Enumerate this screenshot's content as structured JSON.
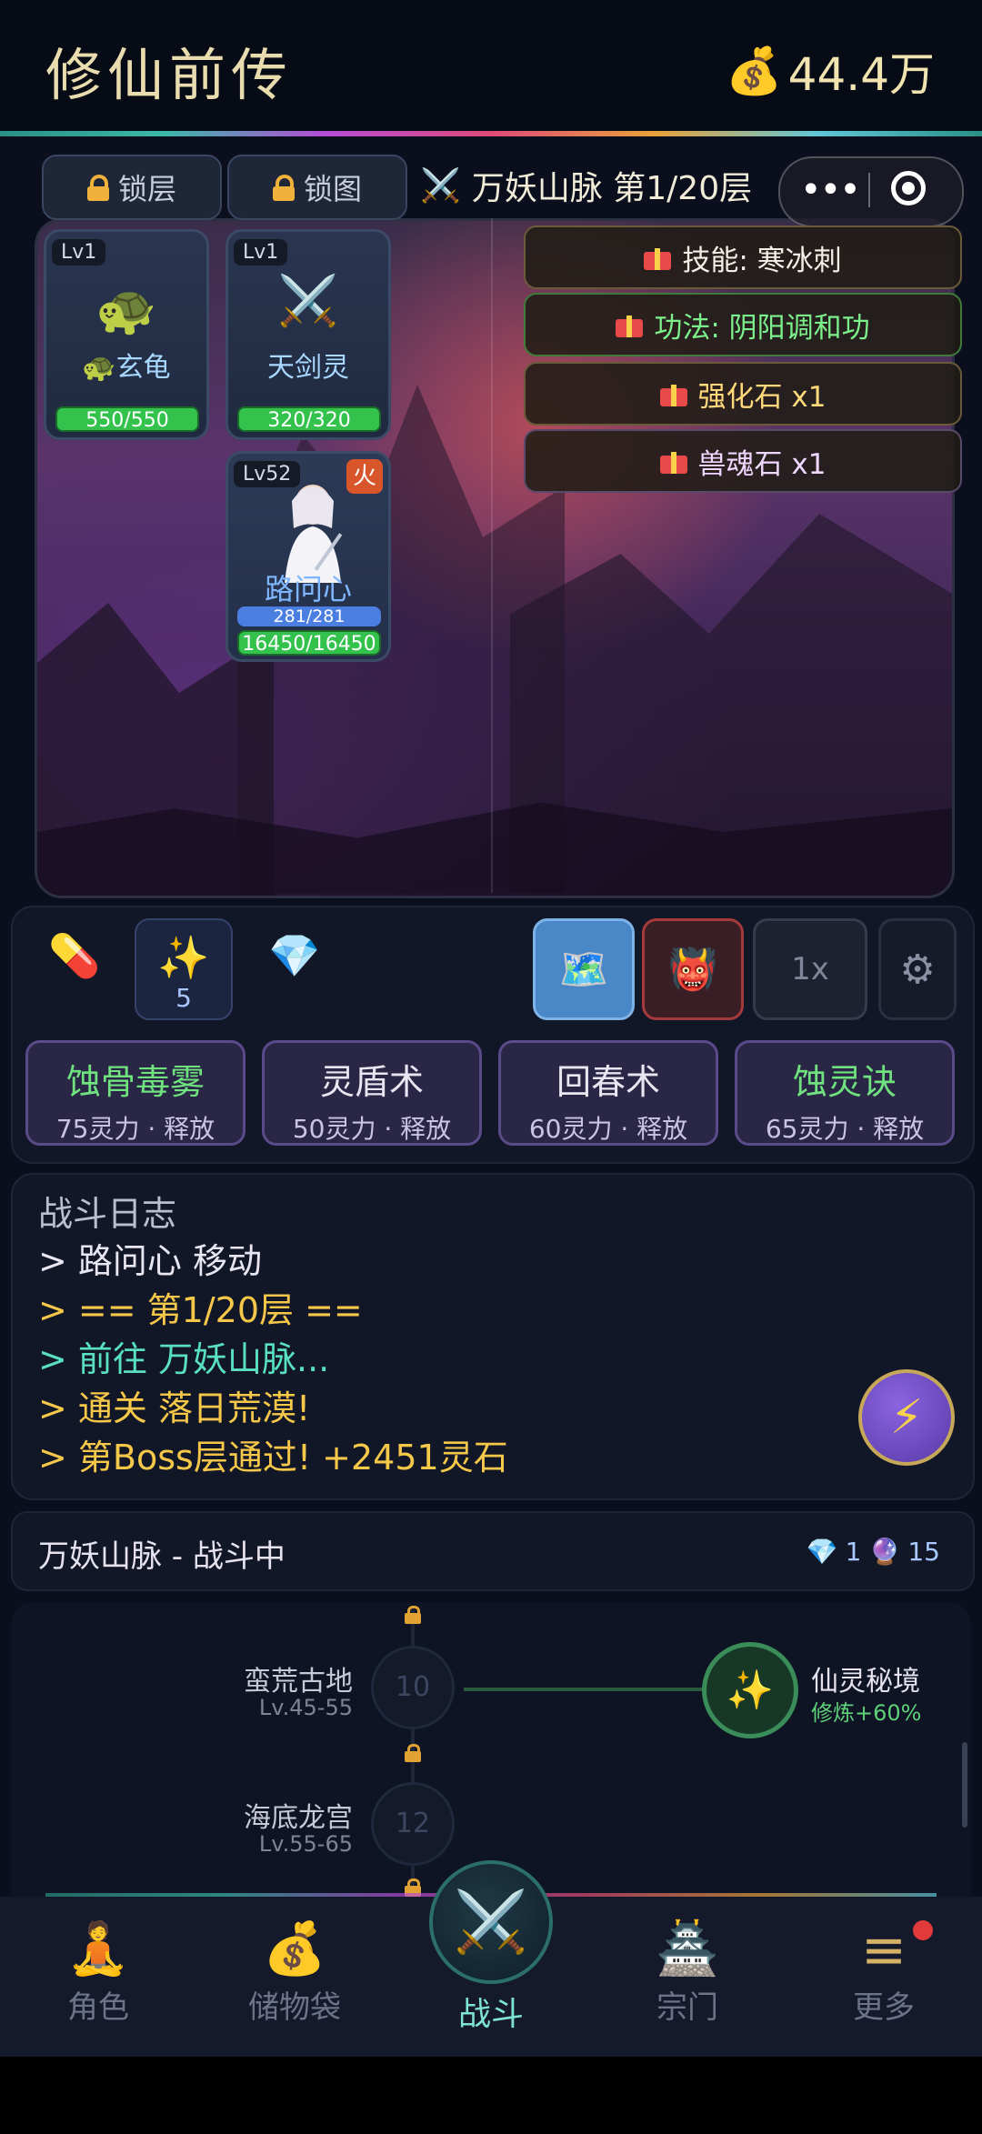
{
  "header": {
    "title": "修仙前传",
    "currency_icon": "money-bag",
    "currency": "44.4万"
  },
  "toolbar": {
    "lock_layer": "锁层",
    "lock_map": "锁图",
    "region": "万妖山脉 第1/20层"
  },
  "units": [
    {
      "level": "Lv1",
      "icon": "🐢",
      "name": "🐢玄龟",
      "hp": "550/550"
    },
    {
      "level": "Lv1",
      "icon": "⚔️",
      "name": "天剑灵",
      "hp": "320/320"
    },
    {
      "level": "Lv52",
      "element": "火",
      "name": "路问心",
      "mp": "281/281",
      "hp": "16450/16450"
    }
  ],
  "loot": [
    {
      "text": "技能: 寒冰刺",
      "color": "#f3efe6"
    },
    {
      "text": "功法: 阴阳调和功",
      "color": "#7cf08a"
    },
    {
      "text": "强化石 x1",
      "color": "#ffd97a"
    },
    {
      "text": "兽魂石 x1",
      "color": "#f0d7ff"
    }
  ],
  "items": [
    {
      "icon": "💊",
      "count": ""
    },
    {
      "icon": "✨",
      "count": "5"
    },
    {
      "icon": "💎",
      "count": ""
    }
  ],
  "tools": {
    "map_icon": "🗺️",
    "demon_icon": "👹",
    "speed": "1x",
    "settings_icon": "⚙"
  },
  "skills": [
    {
      "name": "蚀骨毒雾",
      "cost": "75灵力 · 释放",
      "color": "#6fe27f"
    },
    {
      "name": "灵盾术",
      "cost": "50灵力 · 释放",
      "color": "#ffffff"
    },
    {
      "name": "回春术",
      "cost": "60灵力 · 释放",
      "color": "#ffffff"
    },
    {
      "name": "蚀灵诀",
      "cost": "65灵力 · 释放",
      "color": "#6fe27f"
    }
  ],
  "log": {
    "title": "战斗日志",
    "lines": [
      {
        "text": "> 路问心 移动",
        "color": "#e8e6f0"
      },
      {
        "text": "> == 第1/20层 ==",
        "color": "#f6c84a"
      },
      {
        "text": "> 前往 万妖山脉...",
        "color": "#59e0c0"
      },
      {
        "text": "> 通关 落日荒漠!",
        "color": "#f6c84a"
      },
      {
        "text": "> 第Boss层通过! +2451灵石",
        "color": "#f6c84a"
      }
    ]
  },
  "status": {
    "text": "万妖山脉 - 战斗中",
    "gems": "1",
    "orbs": "15"
  },
  "map": {
    "nodes": [
      {
        "name": "蛮荒古地",
        "lv": "Lv.45-55",
        "num": "10"
      },
      {
        "name": "海底龙宫",
        "lv": "Lv.55-65",
        "num": "12"
      }
    ],
    "special": {
      "name": "仙灵秘境",
      "desc": "修炼+60%"
    }
  },
  "nav": [
    {
      "label": "角色",
      "icon": "🧘"
    },
    {
      "label": "储物袋",
      "icon": "💰"
    },
    {
      "label": "战斗",
      "icon": "⚔️"
    },
    {
      "label": "宗门",
      "icon": "🏯"
    },
    {
      "label": "更多",
      "icon": "≡"
    }
  ]
}
